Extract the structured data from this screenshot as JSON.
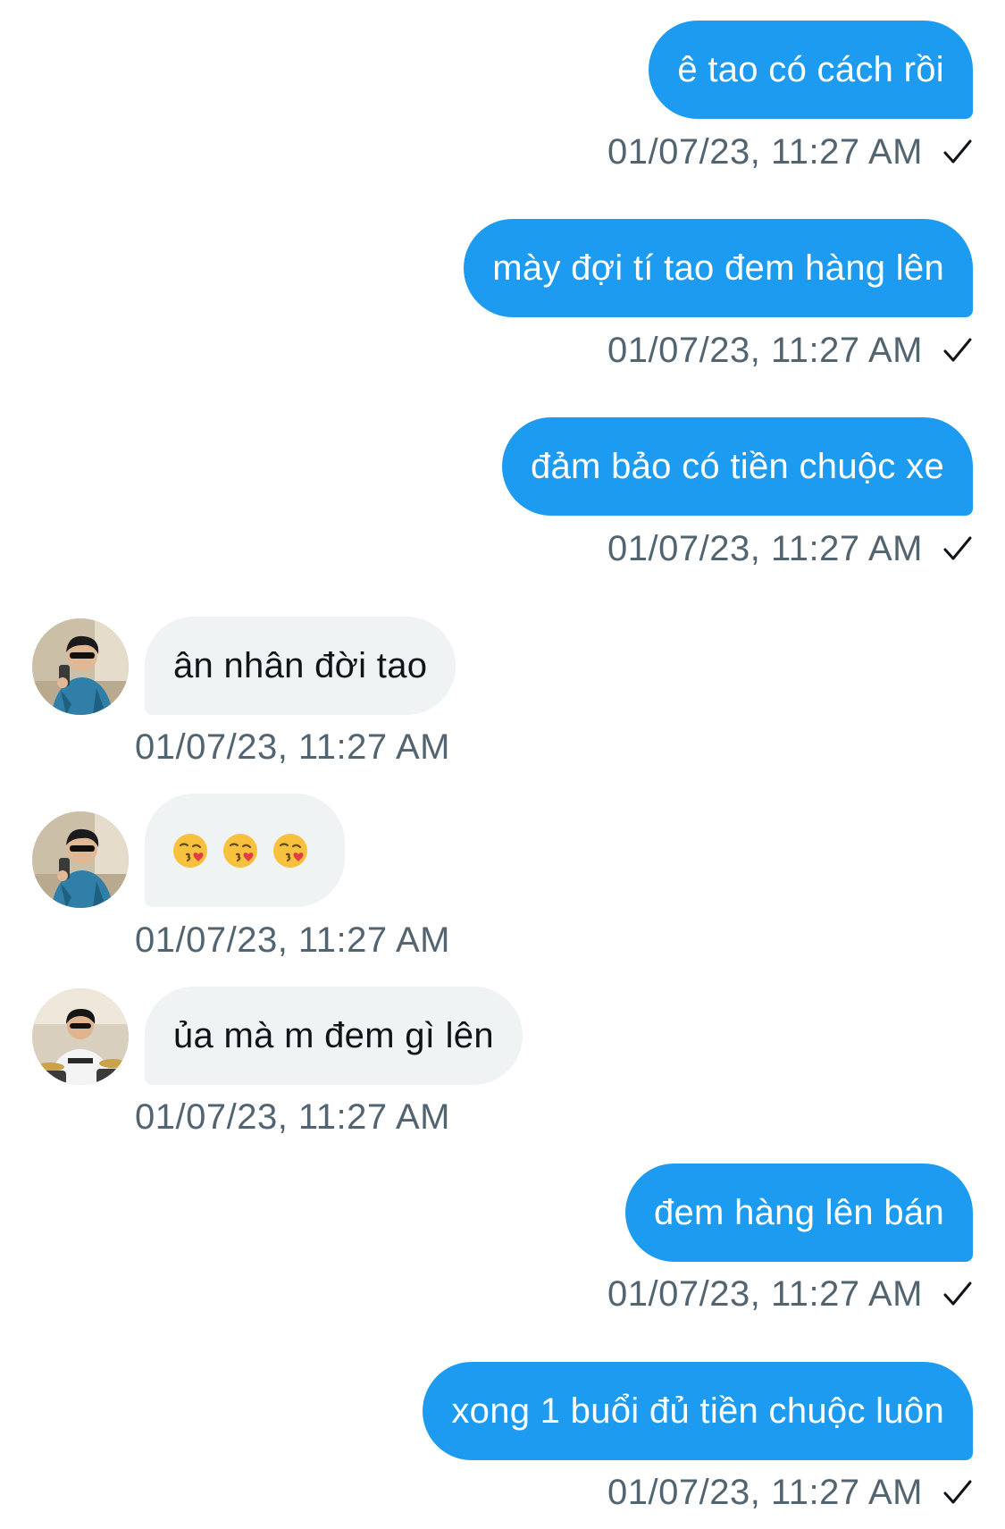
{
  "conversation": {
    "messages": [
      {
        "direction": "out",
        "text": "ê tao có cách rồi",
        "time": "01/07/23, 11:27 AM",
        "status_icon": "check-icon"
      },
      {
        "direction": "out",
        "text": "mày đợi tí tao đem hàng lên",
        "time": "01/07/23, 11:27 AM",
        "status_icon": "check-icon"
      },
      {
        "direction": "out",
        "text": "đảm bảo có tiền chuộc xe",
        "time": "01/07/23, 11:27 AM",
        "status_icon": "check-icon"
      },
      {
        "direction": "in",
        "text": "ân nhân đời tao",
        "time": "01/07/23, 11:27 AM",
        "avatar": "avatar-mirror-selfie"
      },
      {
        "direction": "in",
        "emojis": [
          "😘",
          "😘",
          "😘"
        ],
        "time": "01/07/23, 11:27 AM",
        "avatar": "avatar-mirror-selfie"
      },
      {
        "direction": "in",
        "text": "ủa mà m đem gì lên",
        "time": "01/07/23, 11:27 AM",
        "avatar": "avatar-drummer"
      },
      {
        "direction": "out",
        "text": "đem hàng lên bán",
        "time": "01/07/23, 11:27 AM",
        "status_icon": "check-icon"
      },
      {
        "direction": "out",
        "text": "xong 1 buổi đủ tiền chuộc luôn",
        "time": "01/07/23, 11:27 AM",
        "status_icon": "check-icon"
      }
    ]
  },
  "colors": {
    "outgoing_bubble": "#1d9bf0",
    "incoming_bubble": "#eff3f4",
    "timestamp": "#536471",
    "text_dark": "#0f1419"
  }
}
